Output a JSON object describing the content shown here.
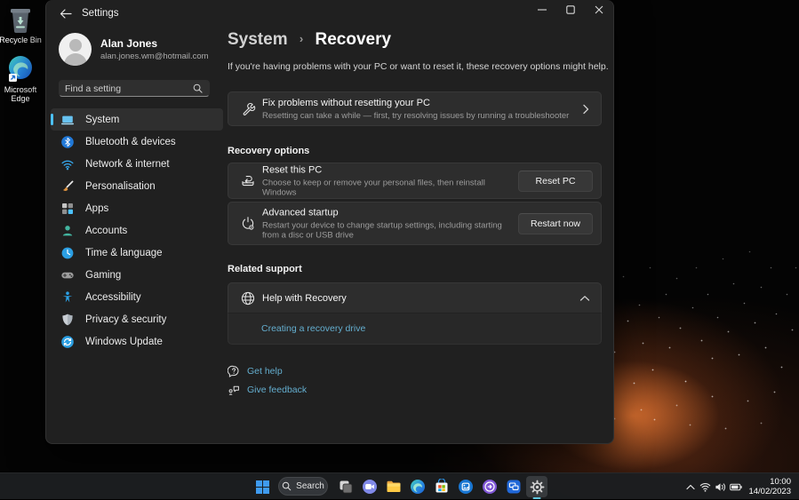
{
  "colors": {
    "accent": "#4cc2ff",
    "link": "#64aecf",
    "window_bg": "#202020",
    "card_bg": "#2d2d2d",
    "taskbar_bg": "#1c1e20"
  },
  "desktop": {
    "icons": [
      {
        "label": "Recycle Bin"
      },
      {
        "label_line1": "Microsoft",
        "label_line2": "Edge"
      }
    ]
  },
  "window": {
    "titlebar": {
      "title": "Settings"
    },
    "sidebar": {
      "user": {
        "name": "Alan Jones",
        "email": "alan.jones.wm@hotmail.com"
      },
      "search": {
        "placeholder": "Find a setting"
      },
      "items": [
        {
          "label": "System",
          "icon": "system-icon",
          "selected": true
        },
        {
          "label": "Bluetooth & devices",
          "icon": "bluetooth-icon",
          "selected": false
        },
        {
          "label": "Network & internet",
          "icon": "network-icon",
          "selected": false
        },
        {
          "label": "Personalisation",
          "icon": "personalisation-icon",
          "selected": false
        },
        {
          "label": "Apps",
          "icon": "apps-icon",
          "selected": false
        },
        {
          "label": "Accounts",
          "icon": "accounts-icon",
          "selected": false
        },
        {
          "label": "Time & language",
          "icon": "time-language-icon",
          "selected": false
        },
        {
          "label": "Gaming",
          "icon": "gaming-icon",
          "selected": false
        },
        {
          "label": "Accessibility",
          "icon": "accessibility-icon",
          "selected": false
        },
        {
          "label": "Privacy & security",
          "icon": "privacy-security-icon",
          "selected": false
        },
        {
          "label": "Windows Update",
          "icon": "windows-update-icon",
          "selected": false
        }
      ]
    },
    "content": {
      "breadcrumb": {
        "parent": "System",
        "separator": "›",
        "current": "Recovery"
      },
      "intro": "If you're having problems with your PC or want to reset it, these recovery options might help.",
      "fix_card": {
        "title": "Fix problems without resetting your PC",
        "subtitle": "Resetting can take a while — first, try resolving issues by running a troubleshooter"
      },
      "recovery_options_label": "Recovery options",
      "reset_card": {
        "title": "Reset this PC",
        "subtitle": "Choose to keep or remove your personal files, then reinstall Windows",
        "button": "Reset PC"
      },
      "advanced_card": {
        "title": "Advanced startup",
        "subtitle": "Restart your device to change startup settings, including starting from a disc or USB drive",
        "button": "Restart now"
      },
      "related_support_label": "Related support",
      "help_card": {
        "title": "Help with Recovery",
        "link": "Creating a recovery drive"
      },
      "footer": {
        "get_help": "Get help",
        "give_feedback": "Give feedback"
      }
    }
  },
  "taskbar": {
    "search_label": "Search",
    "pinned_apps": [
      "start",
      "search",
      "task-view",
      "chat",
      "file-explorer",
      "edge",
      "store",
      "pinned-app-blue",
      "get-started",
      "pinned-app-screens",
      "settings-active"
    ],
    "tray": {
      "time": "10:00",
      "date": "14/02/2023"
    }
  }
}
